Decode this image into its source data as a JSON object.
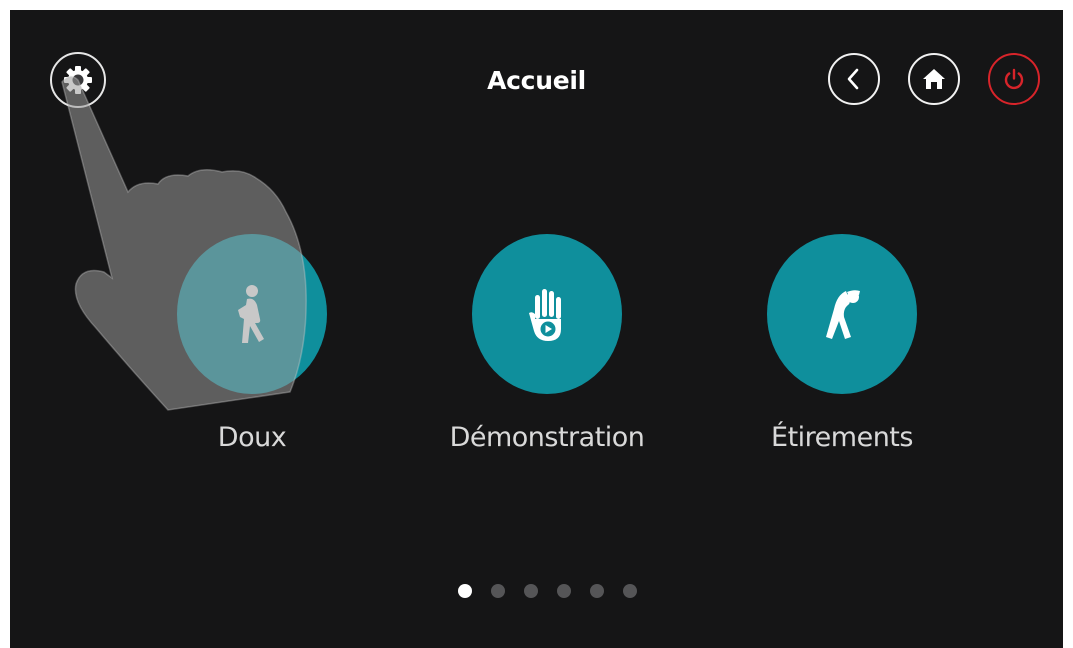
{
  "header": {
    "title": "Accueil"
  },
  "toolbar": {
    "settings_icon": "gear-icon",
    "back_icon": "chevron-left-icon",
    "home_icon": "home-icon",
    "power_icon": "power-icon",
    "power_color": "#d8242a"
  },
  "modes": [
    {
      "label": "Doux",
      "icon": "walking-person-icon"
    },
    {
      "label": "Démonstration",
      "icon": "hand-play-icon"
    },
    {
      "label": "Étirements",
      "icon": "stretching-person-icon"
    }
  ],
  "pagination": {
    "total_pages": 6,
    "current_page": 1
  },
  "colors": {
    "background": "#151516",
    "accent": "#0f8f9c",
    "power": "#d8242a"
  }
}
